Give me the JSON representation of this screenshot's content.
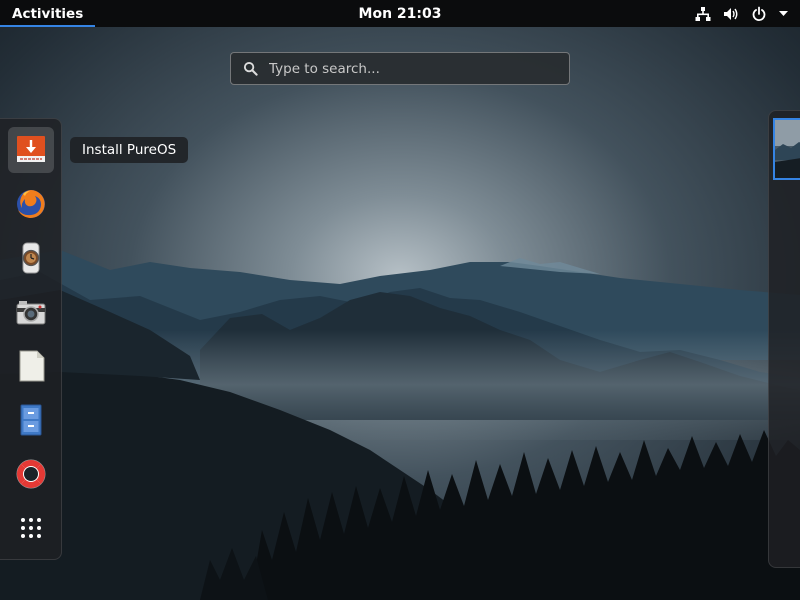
{
  "topbar": {
    "activities_label": "Activities",
    "clock": "Mon 21:03",
    "tray_icons": [
      "network-wired-icon",
      "volume-icon",
      "power-icon",
      "menu-caret-icon"
    ]
  },
  "search": {
    "placeholder": "Type to search...",
    "value": "",
    "icon": "search-icon"
  },
  "dash": {
    "hovered_tooltip": "Install PureOS",
    "items": [
      {
        "icon": "install-pureos-icon",
        "active": true
      },
      {
        "icon": "firefox-icon",
        "active": false
      },
      {
        "icon": "watch-icon",
        "active": false
      },
      {
        "icon": "camera-icon",
        "active": false
      },
      {
        "icon": "document-icon",
        "active": false
      },
      {
        "icon": "file-cabinet-icon",
        "active": false
      },
      {
        "icon": "help-lifebuoy-icon",
        "active": false
      },
      {
        "icon": "show-applications-icon",
        "active": false
      }
    ]
  },
  "workspaces": {
    "count": 1,
    "active_index": 0
  },
  "colors": {
    "accent": "#3584e4",
    "topbar": "#0b0c0d"
  }
}
